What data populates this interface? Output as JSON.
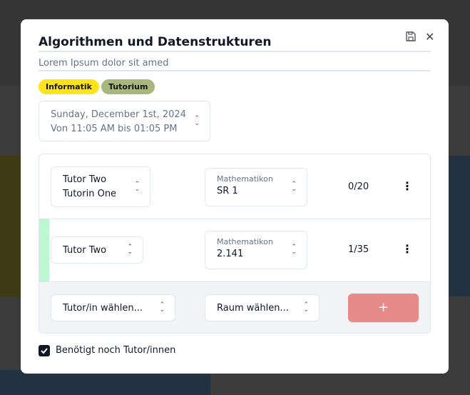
{
  "course": {
    "title": "Algorithmen und Datenstrukturen",
    "description": "Lorem Ipsum dolor sit amed"
  },
  "tags": [
    {
      "label": "Informatik",
      "color": "#fde31a"
    },
    {
      "label": "Tutorium",
      "color": "#a8b87d"
    }
  ],
  "date": {
    "line1": "Sunday, December 1st, 2024",
    "line2": "Von 11:05 AM bis 01:05 PM"
  },
  "sessions": [
    {
      "tutors": [
        "Tutor Two",
        "Tutorin One"
      ],
      "building": "Mathematikon",
      "room": "SR 1",
      "capacity": "0/20"
    },
    {
      "tutors": [
        "Tutor Two"
      ],
      "building": "Mathematikon",
      "room": "2.141",
      "capacity": "1/35"
    }
  ],
  "add_row": {
    "tutor_placeholder": "Tutor/in wählen...",
    "room_placeholder": "Raum wählen...",
    "add_label": "+"
  },
  "needs_tutors": {
    "label": "Benötigt noch Tutor/innen",
    "checked": true
  }
}
